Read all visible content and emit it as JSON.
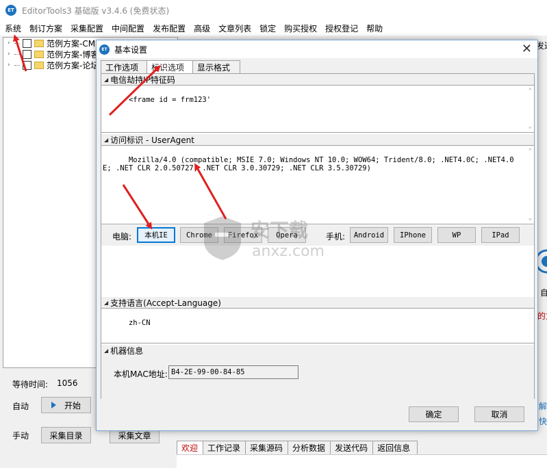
{
  "app": {
    "title": "EditorTools3 基础版 v3.4.6 (免费状态)",
    "logo_text": "ET"
  },
  "menu": [
    "系统",
    "制订方案",
    "采集配置",
    "中间配置",
    "发布配置",
    "高级",
    "文章列表",
    "锁定",
    "购买授权",
    "授权登记",
    "帮助"
  ],
  "tree": {
    "items": [
      {
        "label": "范例方案-CMS"
      },
      {
        "label": "范例方案-博客"
      },
      {
        "label": "范例方案-论坛"
      }
    ]
  },
  "left_panel": {
    "wait_label": "等待时间:",
    "wait_value": "1056",
    "auto_label": "自动",
    "start_label": "开始",
    "manual_label": "手动",
    "collect_dir_label": "采集目录",
    "collect_article_label": "采集文章"
  },
  "bottom_tabs": [
    {
      "label": "欢迎",
      "active": true
    },
    {
      "label": "工作记录",
      "active": false
    },
    {
      "label": "采集源码",
      "active": false
    },
    {
      "label": "分析数据",
      "active": false
    },
    {
      "label": "发送代码",
      "active": false
    },
    {
      "label": "返回信息",
      "active": false
    }
  ],
  "right_fragments": {
    "top": "发达",
    "mid1": "自",
    "mid2": "的方",
    "mid3": "解",
    "mid4": "快"
  },
  "dialog": {
    "title": "基本设置",
    "logo_text": "ET",
    "close_glyph": "✕",
    "tabs": [
      {
        "label": "工作选项",
        "active": false
      },
      {
        "label": "标识选项",
        "active": true
      },
      {
        "label": "显示格式",
        "active": false
      }
    ],
    "telecom": {
      "header": "电信劫持IP特征码",
      "value": "<frame id = frm123'"
    },
    "useragent": {
      "header": "访问标识 - UserAgent",
      "value": "Mozilla/4.0 (compatible; MSIE 7.0; Windows NT 10.0; WOW64; Trident/8.0; .NET4.0C; .NET4.0E; .NET CLR 2.0.50727; .NET CLR 3.0.30729; .NET CLR 3.5.30729)"
    },
    "pc_label": "电脑:",
    "pc_buttons": [
      "本机IE",
      "Chrome",
      "Firefox",
      "Opera"
    ],
    "mobile_label": "手机:",
    "mobile_buttons": [
      "Android",
      "IPhone",
      "WP",
      "IPad"
    ],
    "language": {
      "header": "支持语言(Accept-Language)",
      "value": "zh-CN"
    },
    "machine": {
      "header": "机器信息",
      "mac_label": "本机MAC地址:",
      "mac_value": "B4-2E-99-00-84-85"
    },
    "ok_label": "确定",
    "cancel_label": "取消"
  },
  "watermark": {
    "text": "安下载",
    "url": "anxz.com"
  },
  "colors": {
    "accent": "#1e73be",
    "annotation": "#e02020",
    "active_tab_text": "#c00000"
  }
}
